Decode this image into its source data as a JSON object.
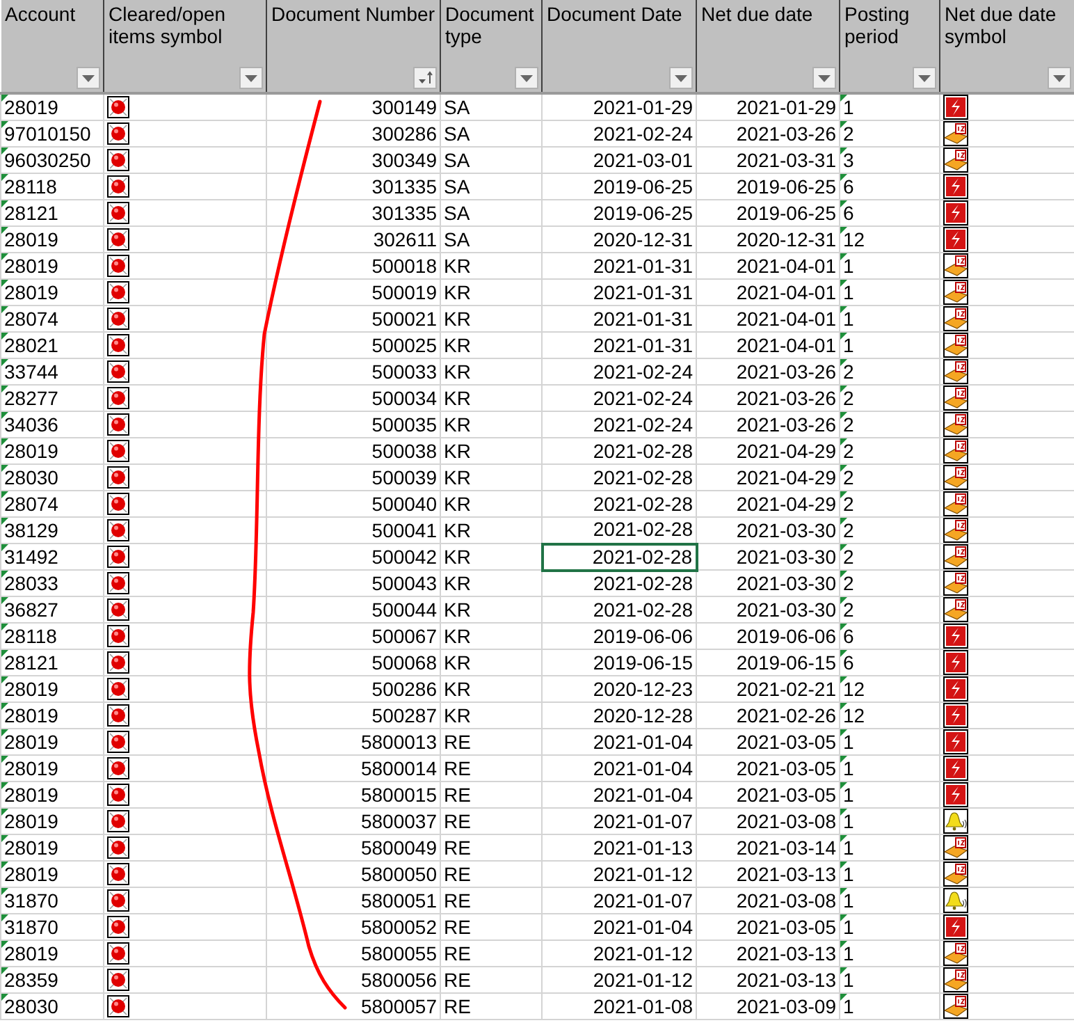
{
  "columns": [
    {
      "label": "Account",
      "kind": "filter"
    },
    {
      "label": "Cleared/open items symbol",
      "kind": "filter"
    },
    {
      "label": "Document Number",
      "kind": "sorted"
    },
    {
      "label": "Document type",
      "kind": "filter"
    },
    {
      "label": "Document Date",
      "kind": "filter"
    },
    {
      "label": "Net due date",
      "kind": "filter"
    },
    {
      "label": "Posting period",
      "kind": "filter"
    },
    {
      "label": "Net due date symbol",
      "kind": "filter"
    }
  ],
  "rows": [
    {
      "account": "28019",
      "cleared_symbol": {
        "kind": "open"
      },
      "document_number": "300149",
      "document_type": "SA",
      "document_date": "2021-01-29",
      "net_due_date": "2021-01-29",
      "posting_period": "1",
      "due_symbol": {
        "kind": "overdue"
      },
      "date_selected": false
    },
    {
      "account": "97010150",
      "cleared_symbol": {
        "kind": "open"
      },
      "document_number": "300286",
      "document_type": "SA",
      "document_date": "2021-02-24",
      "net_due_date": "2021-03-26",
      "posting_period": "2",
      "due_symbol": {
        "kind": "scheduled"
      },
      "date_selected": false
    },
    {
      "account": "96030250",
      "cleared_symbol": {
        "kind": "open"
      },
      "document_number": "300349",
      "document_type": "SA",
      "document_date": "2021-03-01",
      "net_due_date": "2021-03-31",
      "posting_period": "3",
      "due_symbol": {
        "kind": "scheduled"
      },
      "date_selected": false
    },
    {
      "account": "28118",
      "cleared_symbol": {
        "kind": "open"
      },
      "document_number": "301335",
      "document_type": "SA",
      "document_date": "2019-06-25",
      "net_due_date": "2019-06-25",
      "posting_period": "6",
      "due_symbol": {
        "kind": "overdue"
      },
      "date_selected": false
    },
    {
      "account": "28121",
      "cleared_symbol": {
        "kind": "open"
      },
      "document_number": "301335",
      "document_type": "SA",
      "document_date": "2019-06-25",
      "net_due_date": "2019-06-25",
      "posting_period": "6",
      "due_symbol": {
        "kind": "overdue"
      },
      "date_selected": false
    },
    {
      "account": "28019",
      "cleared_symbol": {
        "kind": "open"
      },
      "document_number": "302611",
      "document_type": "SA",
      "document_date": "2020-12-31",
      "net_due_date": "2020-12-31",
      "posting_period": "12",
      "due_symbol": {
        "kind": "overdue"
      },
      "date_selected": false
    },
    {
      "account": "28019",
      "cleared_symbol": {
        "kind": "open"
      },
      "document_number": "500018",
      "document_type": "KR",
      "document_date": "2021-01-31",
      "net_due_date": "2021-04-01",
      "posting_period": "1",
      "due_symbol": {
        "kind": "scheduled"
      },
      "date_selected": false
    },
    {
      "account": "28019",
      "cleared_symbol": {
        "kind": "open"
      },
      "document_number": "500019",
      "document_type": "KR",
      "document_date": "2021-01-31",
      "net_due_date": "2021-04-01",
      "posting_period": "1",
      "due_symbol": {
        "kind": "scheduled"
      },
      "date_selected": false
    },
    {
      "account": "28074",
      "cleared_symbol": {
        "kind": "open"
      },
      "document_number": "500021",
      "document_type": "KR",
      "document_date": "2021-01-31",
      "net_due_date": "2021-04-01",
      "posting_period": "1",
      "due_symbol": {
        "kind": "scheduled"
      },
      "date_selected": false
    },
    {
      "account": "28021",
      "cleared_symbol": {
        "kind": "open"
      },
      "document_number": "500025",
      "document_type": "KR",
      "document_date": "2021-01-31",
      "net_due_date": "2021-04-01",
      "posting_period": "1",
      "due_symbol": {
        "kind": "scheduled"
      },
      "date_selected": false
    },
    {
      "account": "33744",
      "cleared_symbol": {
        "kind": "open"
      },
      "document_number": "500033",
      "document_type": "KR",
      "document_date": "2021-02-24",
      "net_due_date": "2021-03-26",
      "posting_period": "2",
      "due_symbol": {
        "kind": "scheduled"
      },
      "date_selected": false
    },
    {
      "account": "28277",
      "cleared_symbol": {
        "kind": "open"
      },
      "document_number": "500034",
      "document_type": "KR",
      "document_date": "2021-02-24",
      "net_due_date": "2021-03-26",
      "posting_period": "2",
      "due_symbol": {
        "kind": "scheduled"
      },
      "date_selected": false
    },
    {
      "account": "34036",
      "cleared_symbol": {
        "kind": "open"
      },
      "document_number": "500035",
      "document_type": "KR",
      "document_date": "2021-02-24",
      "net_due_date": "2021-03-26",
      "posting_period": "2",
      "due_symbol": {
        "kind": "scheduled"
      },
      "date_selected": false
    },
    {
      "account": "28019",
      "cleared_symbol": {
        "kind": "open"
      },
      "document_number": "500038",
      "document_type": "KR",
      "document_date": "2021-02-28",
      "net_due_date": "2021-04-29",
      "posting_period": "2",
      "due_symbol": {
        "kind": "scheduled"
      },
      "date_selected": false
    },
    {
      "account": "28030",
      "cleared_symbol": {
        "kind": "open"
      },
      "document_number": "500039",
      "document_type": "KR",
      "document_date": "2021-02-28",
      "net_due_date": "2021-04-29",
      "posting_period": "2",
      "due_symbol": {
        "kind": "scheduled"
      },
      "date_selected": false
    },
    {
      "account": "28074",
      "cleared_symbol": {
        "kind": "open"
      },
      "document_number": "500040",
      "document_type": "KR",
      "document_date": "2021-02-28",
      "net_due_date": "2021-04-29",
      "posting_period": "2",
      "due_symbol": {
        "kind": "scheduled"
      },
      "date_selected": false
    },
    {
      "account": "38129",
      "cleared_symbol": {
        "kind": "open"
      },
      "document_number": "500041",
      "document_type": "KR",
      "document_date": "2021-02-28",
      "net_due_date": "2021-03-30",
      "posting_period": "2",
      "due_symbol": {
        "kind": "scheduled"
      },
      "date_selected": false
    },
    {
      "account": "31492",
      "cleared_symbol": {
        "kind": "open"
      },
      "document_number": "500042",
      "document_type": "KR",
      "document_date": "2021-02-28",
      "net_due_date": "2021-03-30",
      "posting_period": "2",
      "due_symbol": {
        "kind": "scheduled"
      },
      "date_selected": true
    },
    {
      "account": "28033",
      "cleared_symbol": {
        "kind": "open"
      },
      "document_number": "500043",
      "document_type": "KR",
      "document_date": "2021-02-28",
      "net_due_date": "2021-03-30",
      "posting_period": "2",
      "due_symbol": {
        "kind": "scheduled"
      },
      "date_selected": false
    },
    {
      "account": "36827",
      "cleared_symbol": {
        "kind": "open"
      },
      "document_number": "500044",
      "document_type": "KR",
      "document_date": "2021-02-28",
      "net_due_date": "2021-03-30",
      "posting_period": "2",
      "due_symbol": {
        "kind": "scheduled"
      },
      "date_selected": false
    },
    {
      "account": "28118",
      "cleared_symbol": {
        "kind": "open"
      },
      "document_number": "500067",
      "document_type": "KR",
      "document_date": "2019-06-06",
      "net_due_date": "2019-06-06",
      "posting_period": "6",
      "due_symbol": {
        "kind": "overdue"
      },
      "date_selected": false
    },
    {
      "account": "28121",
      "cleared_symbol": {
        "kind": "open"
      },
      "document_number": "500068",
      "document_type": "KR",
      "document_date": "2019-06-15",
      "net_due_date": "2019-06-15",
      "posting_period": "6",
      "due_symbol": {
        "kind": "overdue"
      },
      "date_selected": false
    },
    {
      "account": "28019",
      "cleared_symbol": {
        "kind": "open"
      },
      "document_number": "500286",
      "document_type": "KR",
      "document_date": "2020-12-23",
      "net_due_date": "2021-02-21",
      "posting_period": "12",
      "due_symbol": {
        "kind": "overdue"
      },
      "date_selected": false
    },
    {
      "account": "28019",
      "cleared_symbol": {
        "kind": "open"
      },
      "document_number": "500287",
      "document_type": "KR",
      "document_date": "2020-12-28",
      "net_due_date": "2021-02-26",
      "posting_period": "12",
      "due_symbol": {
        "kind": "overdue"
      },
      "date_selected": false
    },
    {
      "account": "28019",
      "cleared_symbol": {
        "kind": "open"
      },
      "document_number": "5800013",
      "document_type": "RE",
      "document_date": "2021-01-04",
      "net_due_date": "2021-03-05",
      "posting_period": "1",
      "due_symbol": {
        "kind": "overdue"
      },
      "date_selected": false
    },
    {
      "account": "28019",
      "cleared_symbol": {
        "kind": "open"
      },
      "document_number": "5800014",
      "document_type": "RE",
      "document_date": "2021-01-04",
      "net_due_date": "2021-03-05",
      "posting_period": "1",
      "due_symbol": {
        "kind": "overdue"
      },
      "date_selected": false
    },
    {
      "account": "28019",
      "cleared_symbol": {
        "kind": "open"
      },
      "document_number": "5800015",
      "document_type": "RE",
      "document_date": "2021-01-04",
      "net_due_date": "2021-03-05",
      "posting_period": "1",
      "due_symbol": {
        "kind": "overdue"
      },
      "date_selected": false
    },
    {
      "account": "28019",
      "cleared_symbol": {
        "kind": "open"
      },
      "document_number": "5800037",
      "document_type": "RE",
      "document_date": "2021-01-07",
      "net_due_date": "2021-03-08",
      "posting_period": "1",
      "due_symbol": {
        "kind": "reminder"
      },
      "date_selected": false
    },
    {
      "account": "28019",
      "cleared_symbol": {
        "kind": "open"
      },
      "document_number": "5800049",
      "document_type": "RE",
      "document_date": "2021-01-13",
      "net_due_date": "2021-03-14",
      "posting_period": "1",
      "due_symbol": {
        "kind": "scheduled"
      },
      "date_selected": false
    },
    {
      "account": "28019",
      "cleared_symbol": {
        "kind": "open"
      },
      "document_number": "5800050",
      "document_type": "RE",
      "document_date": "2021-01-12",
      "net_due_date": "2021-03-13",
      "posting_period": "1",
      "due_symbol": {
        "kind": "scheduled"
      },
      "date_selected": false
    },
    {
      "account": "31870",
      "cleared_symbol": {
        "kind": "open"
      },
      "document_number": "5800051",
      "document_type": "RE",
      "document_date": "2021-01-07",
      "net_due_date": "2021-03-08",
      "posting_period": "1",
      "due_symbol": {
        "kind": "reminder"
      },
      "date_selected": false
    },
    {
      "account": "31870",
      "cleared_symbol": {
        "kind": "open"
      },
      "document_number": "5800052",
      "document_type": "RE",
      "document_date": "2021-01-04",
      "net_due_date": "2021-03-05",
      "posting_period": "1",
      "due_symbol": {
        "kind": "overdue"
      },
      "date_selected": false
    },
    {
      "account": "28019",
      "cleared_symbol": {
        "kind": "open"
      },
      "document_number": "5800055",
      "document_type": "RE",
      "document_date": "2021-01-12",
      "net_due_date": "2021-03-13",
      "posting_period": "1",
      "due_symbol": {
        "kind": "scheduled"
      },
      "date_selected": false
    },
    {
      "account": "28359",
      "cleared_symbol": {
        "kind": "open"
      },
      "document_number": "5800056",
      "document_type": "RE",
      "document_date": "2021-01-12",
      "net_due_date": "2021-03-13",
      "posting_period": "1",
      "due_symbol": {
        "kind": "scheduled"
      },
      "date_selected": false
    },
    {
      "account": "28030",
      "cleared_symbol": {
        "kind": "open"
      },
      "document_number": "5800057",
      "document_type": "RE",
      "document_date": "2021-01-08",
      "net_due_date": "2021-03-09",
      "posting_period": "1",
      "due_symbol": {
        "kind": "scheduled"
      },
      "date_selected": false
    }
  ],
  "annotation": {
    "kind": "freehand_line"
  }
}
